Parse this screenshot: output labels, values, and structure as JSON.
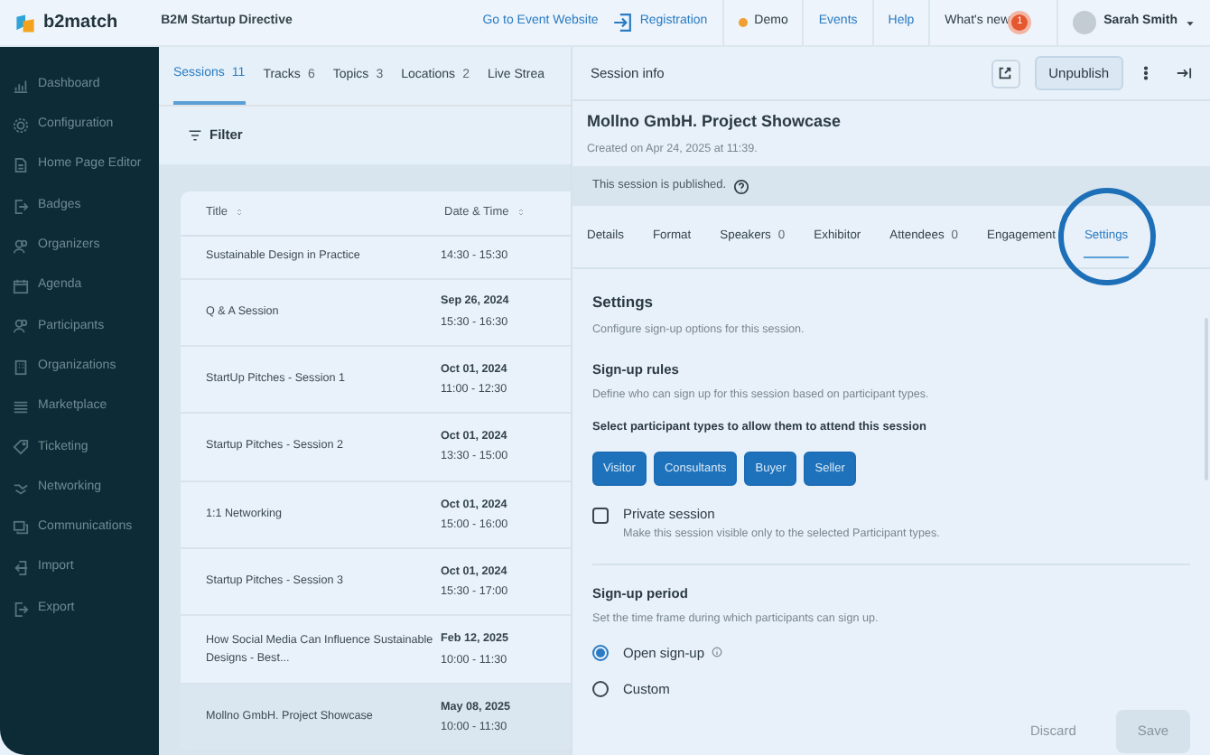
{
  "header": {
    "brand": "b2match",
    "event_name": "B2M Startup Directive",
    "links": [
      {
        "label": "Go to Event Website",
        "kind": "link"
      },
      {
        "label": "Registration",
        "kind": "icon-link"
      }
    ],
    "status": {
      "label": "Demo",
      "color": "#f0a030"
    },
    "nav": [
      {
        "label": "Events"
      },
      {
        "label": "Help"
      }
    ],
    "whats_new": {
      "label": "What's new",
      "badge": "1"
    },
    "user": {
      "name": "Sarah Smith"
    }
  },
  "sidebar": {
    "items": [
      {
        "label": "Dashboard"
      },
      {
        "label": "Configuration"
      },
      {
        "label": "Home Page Editor"
      },
      {
        "label": "Badges"
      },
      {
        "label": "Organizers"
      },
      {
        "label": "Agenda"
      },
      {
        "label": "Participants"
      },
      {
        "label": "Organizations"
      },
      {
        "label": "Marketplace"
      },
      {
        "label": "Ticketing"
      },
      {
        "label": "Networking"
      },
      {
        "label": "Communications"
      },
      {
        "label": "Import"
      },
      {
        "label": "Export"
      }
    ]
  },
  "list_panel": {
    "tabs": [
      {
        "label": "Sessions",
        "count": "11",
        "selected": true
      },
      {
        "label": "Tracks",
        "count": "6",
        "selected": false
      },
      {
        "label": "Topics",
        "count": "3",
        "selected": false
      },
      {
        "label": "Locations",
        "count": "2",
        "selected": false
      },
      {
        "label": "Live Strea",
        "selected": false
      }
    ],
    "filter": "Filter",
    "table": {
      "columns": [
        "Title",
        "Date & Time"
      ],
      "rows": [
        {
          "title": "Sustainable Design in Practice",
          "time": "14:30 - 15:30",
          "selected": false
        },
        {
          "title": "Q & A Session",
          "date": "Sep 26, 2024",
          "time": "15:30 - 16:30",
          "selected": false
        },
        {
          "title": "StartUp Pitches - Session 1",
          "date": "Oct 01, 2024",
          "time": "11:00 - 12:30",
          "selected": false
        },
        {
          "title": "Startup Pitches - Session 2",
          "date": "Oct 01, 2024",
          "time": "13:30 - 15:00",
          "selected": false
        },
        {
          "title": "1:1 Networking",
          "date": "Oct 01, 2024",
          "time": "15:00 - 16:00",
          "selected": false
        },
        {
          "title": "Startup Pitches - Session 3",
          "date": "Oct 01, 2024",
          "time": "15:30 - 17:00",
          "selected": false
        },
        {
          "title": "How Social Media Can Influence Sustainable Designs - Best...",
          "date": "Feb 12, 2025",
          "time": "10:00 - 11:30",
          "selected": false
        },
        {
          "title": "Mollno GmbH. Project Showcase",
          "date": "May 08, 2025",
          "time": "10:00 - 11:30",
          "selected": true
        }
      ]
    }
  },
  "session_panel": {
    "title": "Session info",
    "publish_button": "Unpublish",
    "session_title": "Mollno GmbH. Project Showcase",
    "created": "Created on Apr 24, 2025 at 11:39.",
    "published_notice": "This session is published.",
    "tabs": [
      {
        "label": "Details",
        "selected": false
      },
      {
        "label": "Format",
        "selected": false
      },
      {
        "label": "Speakers",
        "count": "0",
        "selected": false
      },
      {
        "label": "Exhibitor",
        "selected": false
      },
      {
        "label": "Attendees",
        "count": "0",
        "selected": false
      },
      {
        "label": "Engagement",
        "selected": false
      },
      {
        "label": "Settings",
        "selected": true,
        "highlighted": true
      }
    ],
    "settings": {
      "heading": "Settings",
      "description": "Configure sign-up options for this session.",
      "rules": {
        "heading": "Sign-up rules",
        "description": "Define who can sign up for this session based on participant types.",
        "prompt": "Select participant types to allow them to attend this session",
        "types": [
          {
            "label": "Visitor",
            "selected": true
          },
          {
            "label": "Consultants",
            "selected": true
          },
          {
            "label": "Buyer",
            "selected": true
          },
          {
            "label": "Seller",
            "selected": true
          }
        ]
      },
      "private": {
        "label": "Private session",
        "description": "Make this session visible only to the selected Participant types.",
        "checked": false
      },
      "period": {
        "heading": "Sign-up period",
        "description": "Set the time frame during which participants can sign up.",
        "options": [
          {
            "label": "Open sign-up",
            "selected": true,
            "info": true
          },
          {
            "label": "Custom",
            "selected": false,
            "info": false
          }
        ]
      }
    },
    "buttons": [
      {
        "label": "Discard",
        "kind": "text"
      },
      {
        "label": "Save",
        "kind": "primary",
        "disabled": true
      }
    ]
  }
}
